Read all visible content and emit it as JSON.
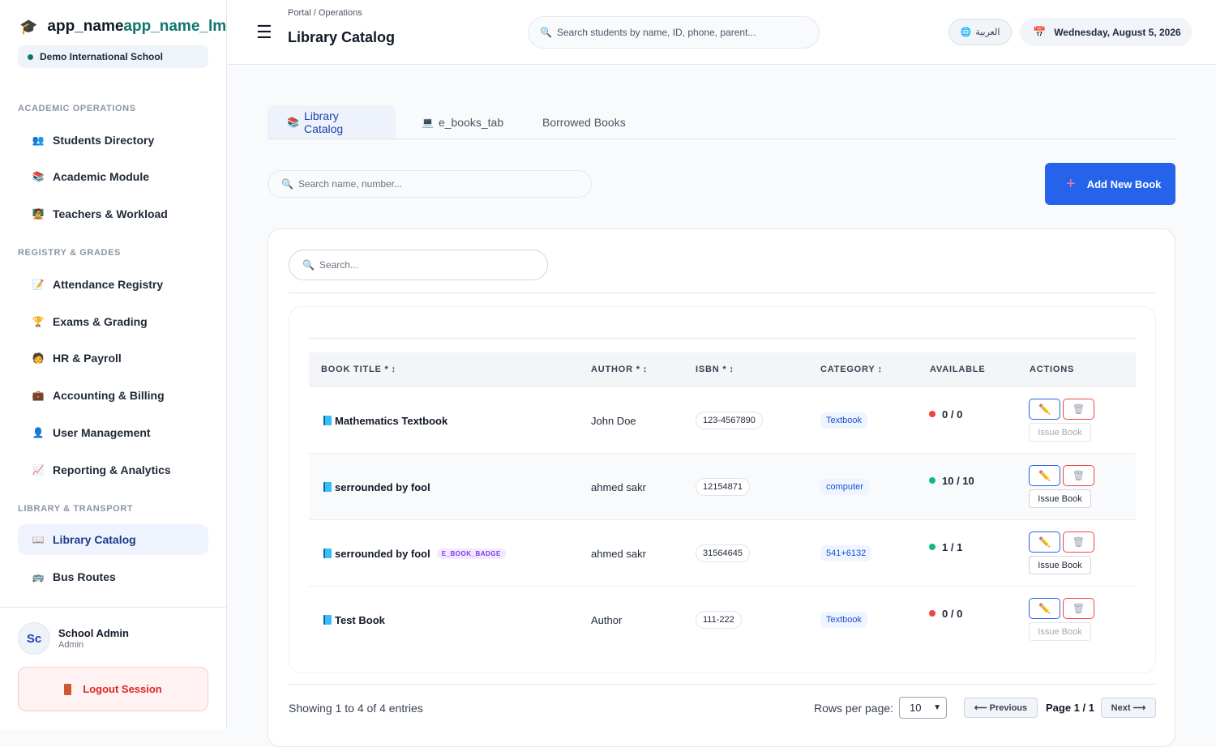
{
  "app": {
    "name_part1": "app_name",
    "name_part2": "app_name_lms",
    "school": "Demo International School"
  },
  "sidebar": {
    "sections": [
      {
        "label": "ACADEMIC OPERATIONS"
      },
      {
        "label": "REGISTRY & GRADES"
      },
      {
        "label": "LIBRARY & TRANSPORT"
      }
    ],
    "items": [
      {
        "label": "Students Directory",
        "icon": "students-icon"
      },
      {
        "label": "Academic Module",
        "icon": "books-icon"
      },
      {
        "label": "Teachers & Workload",
        "icon": "teachers-icon"
      },
      {
        "label": "Attendance Registry",
        "icon": "attendance-icon"
      },
      {
        "label": "Exams & Grading",
        "icon": "trophy-icon"
      },
      {
        "label": "HR & Payroll",
        "icon": "person-icon"
      },
      {
        "label": "Accounting & Billing",
        "icon": "briefcase-icon"
      },
      {
        "label": "User Management",
        "icon": "user-icon"
      },
      {
        "label": "Reporting & Analytics",
        "icon": "chart-icon"
      },
      {
        "label": "Library Catalog",
        "icon": "open-book-icon",
        "active": true
      },
      {
        "label": "Bus Routes",
        "icon": "bus-icon"
      }
    ],
    "user": {
      "initials": "Sc",
      "name": "School Admin",
      "role": "Admin"
    },
    "logout_label": "Logout Session"
  },
  "header": {
    "breadcrumb": "Portal / Operations",
    "title": "Library Catalog",
    "search_placeholder": "Search students by name, ID, phone, parent...",
    "lang_label": "العربية",
    "date": "Wednesday, August 5, 2026"
  },
  "tabs": [
    {
      "label": "Library Catalog",
      "active": true
    },
    {
      "label": "e_books_tab"
    },
    {
      "label": "Borrowed Books"
    }
  ],
  "toolbar": {
    "search_placeholder": "Search name, number...",
    "add_label": "Add New Book"
  },
  "table": {
    "search_placeholder": "Search...",
    "columns": {
      "title": "BOOK TITLE *",
      "author": "AUTHOR *",
      "isbn": "ISBN *",
      "category": "CATEGORY",
      "available": "AVAILABLE",
      "actions": "ACTIONS"
    },
    "sort_glyph": "↕",
    "ebook_badge": "E_BOOK_BADGE",
    "issue_label": "Issue Book",
    "rows": [
      {
        "title": "Mathematics Textbook",
        "author": "John Doe",
        "isbn": "123-4567890",
        "category": "Textbook",
        "available": "0 / 0",
        "status": "unavailable",
        "ebook": false
      },
      {
        "title": "serrounded by fool",
        "author": "ahmed sakr",
        "isbn": "12154871",
        "category": "computer",
        "available": "10 / 10",
        "status": "available",
        "ebook": false
      },
      {
        "title": "serrounded by fool",
        "author": "ahmed sakr",
        "isbn": "31564645",
        "category": "541+6132",
        "available": "1 / 1",
        "status": "available",
        "ebook": true
      },
      {
        "title": "Test Book",
        "author": "Author",
        "isbn": "111-222",
        "category": "Textbook",
        "available": "0 / 0",
        "status": "unavailable",
        "ebook": false
      }
    ]
  },
  "pagination": {
    "showing": "Showing 1 to 4 of 4 entries",
    "rows_label": "Rows per page:",
    "rows_value": "10",
    "prev_label": "⟵ Previous",
    "page": "Page 1 / 1",
    "next_label": "Next ⟶"
  },
  "colors": {
    "accent": "#2563eb",
    "brand_green": "#0f766e",
    "available": "#10b981",
    "unavailable": "#ef4444"
  }
}
